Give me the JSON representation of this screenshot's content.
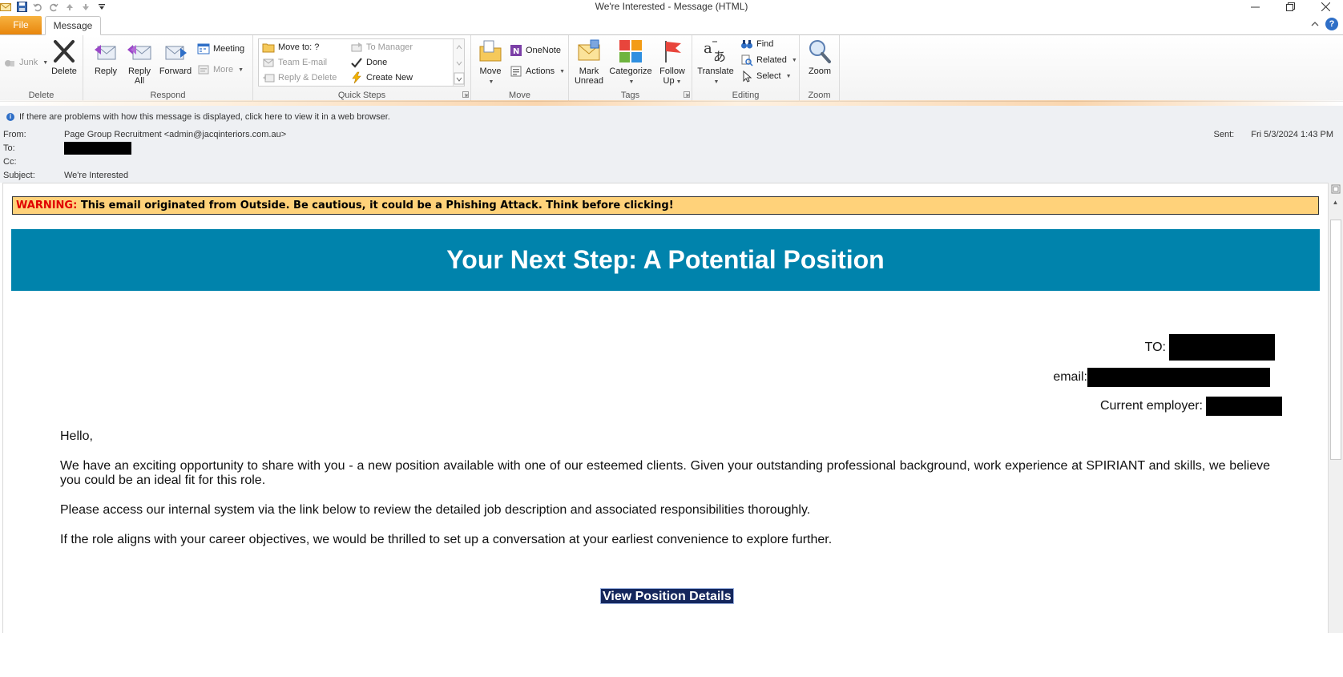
{
  "window": {
    "title": "We're Interested  -  Message (HTML)"
  },
  "tabs": {
    "file": "File",
    "message": "Message"
  },
  "ribbon": {
    "delete_group": {
      "label": "Delete",
      "junk": "Junk",
      "delete": "Delete"
    },
    "respond_group": {
      "label": "Respond",
      "reply": "Reply",
      "reply_all_line1": "Reply",
      "reply_all_line2": "All",
      "forward": "Forward",
      "meeting": "Meeting",
      "more": "More"
    },
    "quick_steps_group": {
      "label": "Quick Steps",
      "move_to": "Move to: ?",
      "team_email": "Team E-mail",
      "reply_delete": "Reply & Delete",
      "to_manager": "To Manager",
      "done": "Done",
      "create_new": "Create New"
    },
    "move_group": {
      "label": "Move",
      "move": "Move",
      "onenote": "OneNote",
      "actions": "Actions"
    },
    "tags_group": {
      "label": "Tags",
      "mark_unread_line1": "Mark",
      "mark_unread_line2": "Unread",
      "categorize": "Categorize",
      "follow_up_line1": "Follow",
      "follow_up_line2": "Up"
    },
    "editing_group": {
      "label": "Editing",
      "translate": "Translate",
      "find": "Find",
      "related": "Related",
      "select": "Select"
    },
    "zoom_group": {
      "label": "Zoom",
      "zoom": "Zoom"
    }
  },
  "header": {
    "infobar": "If there are problems with how this message is displayed, click here to view it in a web browser.",
    "from_label": "From:",
    "from_value": "Page Group Recruitment <admin@jacqinteriors.com.au>",
    "to_label": "To:",
    "cc_label": "Cc:",
    "subject_label": "Subject:",
    "subject_value": "We're Interested",
    "sent_label": "Sent:",
    "sent_value": "Fri 5/3/2024 1:43 PM"
  },
  "email": {
    "warning_label": "WARNING:",
    "warning_text": " This email originated from Outside. Be cautious, it could be a Phishing Attack. Think before clicking!",
    "banner_title": "Your Next Step: A Potential Position",
    "to_label": "TO:",
    "email_label": "email:",
    "employer_label": "Current employer:",
    "greeting": "Hello,",
    "paragraph_1": "We have an exciting opportunity to share with you - a new position available with one of our esteemed clients. Given your outstanding professional background, work experience at SPIRIANT and skills, we believe you could be an ideal fit for this role.",
    "paragraph_2": "Please access our internal system via the link below to review the detailed job description and associated responsibilities thoroughly.",
    "paragraph_3": "If the role aligns with your career objectives, we would be thrilled to set up a conversation at your earliest convenience to explore further.",
    "cta": "View Position Details"
  },
  "colors": {
    "banner": "#0083ac",
    "warning_bg": "#ffd27a",
    "warning_label": "#e00000",
    "cta_bg": "#14265c",
    "file_tab": "#f39c16"
  }
}
